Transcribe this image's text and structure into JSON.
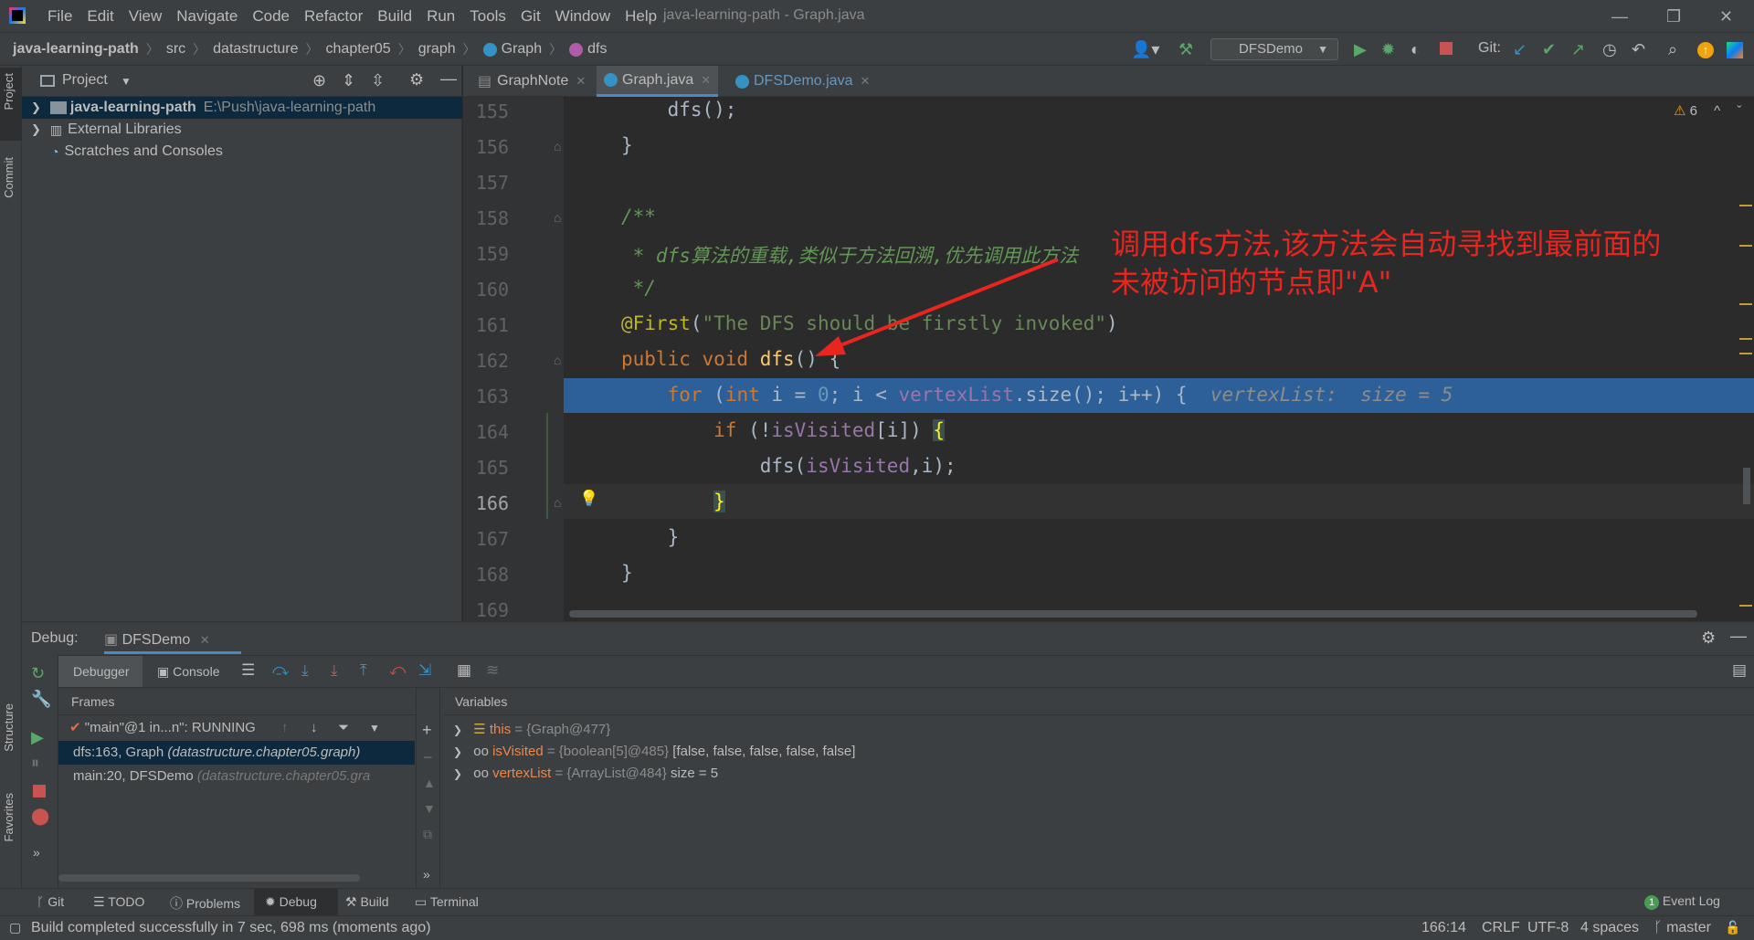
{
  "titlebar": {
    "menu": [
      "File",
      "Edit",
      "View",
      "Navigate",
      "Code",
      "Refactor",
      "Build",
      "Run",
      "Tools",
      "Git",
      "Window",
      "Help"
    ],
    "title": "java-learning-path - Graph.java"
  },
  "breadcrumb": {
    "project": "java-learning-path",
    "items": [
      "src",
      "datastructure",
      "chapter05",
      "graph"
    ],
    "class": "Graph",
    "method": "dfs"
  },
  "toolbar": {
    "run_config": "DFSDemo",
    "git_label": "Git:"
  },
  "leftstrip": {
    "project": "Project",
    "commit": "Commit",
    "structure": "Structure",
    "favorites": "Favorites"
  },
  "project": {
    "title": "Project",
    "root_name": "java-learning-path",
    "root_path": "E:\\Push\\java-learning-path",
    "external": "External Libraries",
    "scratches": "Scratches and Consoles"
  },
  "tabs": [
    {
      "label": "GraphNote"
    },
    {
      "label": "Graph.java"
    },
    {
      "label": "DFSDemo.java"
    }
  ],
  "editor": {
    "warnings": "6",
    "line_numbers": [
      "155",
      "156",
      "157",
      "158",
      "159",
      "160",
      "161",
      "162",
      "163",
      "164",
      "165",
      "166",
      "167",
      "168",
      "169"
    ],
    "hint_var": "vertexList:",
    "hint_val": "size = 5"
  },
  "annotation": {
    "line1": "调用dfs方法,该方法会自动寻找到最前面的",
    "line2": "未被访问的节点即\"A\""
  },
  "debug": {
    "label": "Debug:",
    "session": "DFSDemo",
    "tab_debugger": "Debugger",
    "tab_console": "Console",
    "frames_title": "Frames",
    "variables_title": "Variables",
    "thread": "\"main\"@1 in...n\": RUNNING",
    "frames": [
      {
        "name": "dfs:163, Graph",
        "pkg": "(datastructure.chapter05.graph)"
      },
      {
        "name": "main:20, DFSDemo",
        "pkg": "(datastructure.chapter05.gra"
      }
    ],
    "variables": [
      {
        "name": "this",
        "value": "= {Graph@477}",
        "extra": ""
      },
      {
        "name": "isVisited",
        "value": "= {boolean[5]@485}",
        "extra": "[false, false, false, false, false]"
      },
      {
        "name": "vertexList",
        "value": "= {ArrayList@484}",
        "extra": "size = 5"
      }
    ]
  },
  "toolwindows": [
    "Git",
    "TODO",
    "Problems",
    "Debug",
    "Build",
    "Terminal"
  ],
  "event_log": {
    "count": "1",
    "label": "Event Log"
  },
  "status": {
    "message": "Build completed successfully in 7 sec, 698 ms (moments ago)",
    "position": "166:14",
    "line_sep": "CRLF",
    "encoding": "UTF-8",
    "indent": "4 spaces",
    "branch": "master"
  }
}
